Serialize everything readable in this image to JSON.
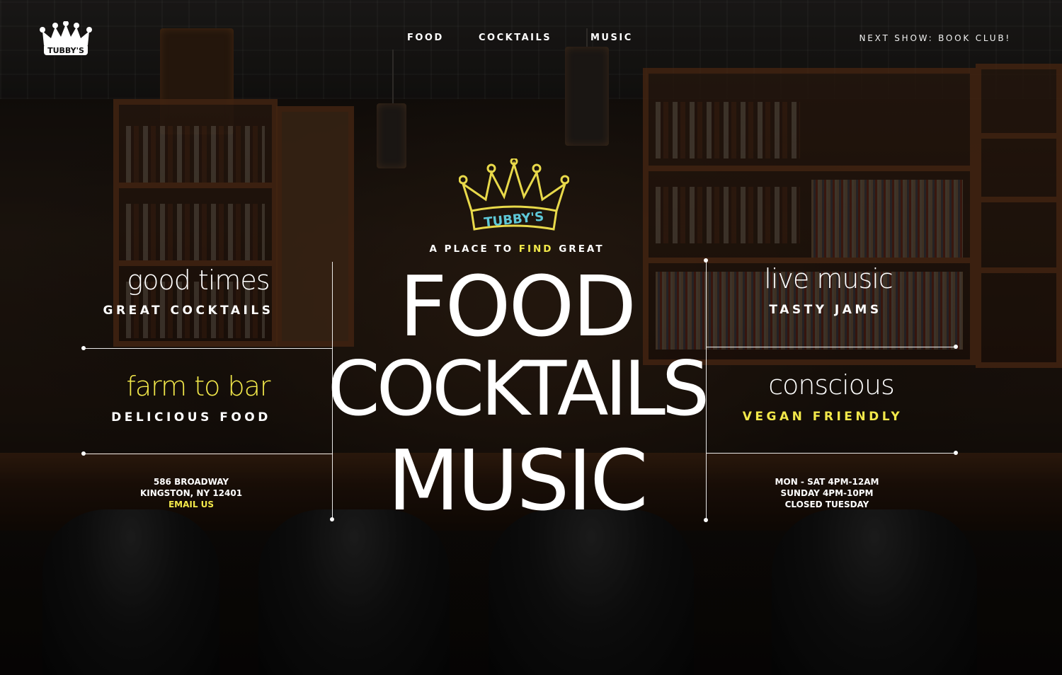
{
  "nav": {
    "logo_text": "TUBBY'S",
    "links": [
      {
        "label": "FOOD"
      },
      {
        "label": "COCKTAILS"
      },
      {
        "label": "MUSIC"
      }
    ],
    "next_show": "NEXT SHOW: BOOK CLUB!"
  },
  "hero": {
    "neon_sign_text": "TUBBY'S",
    "kicker": {
      "before": "A PLACE TO ",
      "highlight": "FIND",
      "after": " GREAT"
    },
    "words": [
      "FOOD",
      "COCKTAILS",
      "MUSIC"
    ]
  },
  "left": {
    "top": {
      "title": "good times",
      "subtitle": "GREAT COCKTAILS"
    },
    "bottom": {
      "title": "farm to bar",
      "subtitle": "DELICIOUS FOOD"
    },
    "address": {
      "line1": "586 BROADWAY",
      "line2": "KINGSTON, NY 12401",
      "email": "EMAIL US"
    }
  },
  "right": {
    "top": {
      "title": "live music",
      "subtitle": "TASTY JAMS"
    },
    "bottom": {
      "title": "conscious",
      "subtitle": "VEGAN FRIENDLY"
    },
    "hours": {
      "line1": "MON - SAT 4PM-12AM",
      "line2": "SUNDAY 4PM-10PM",
      "line3": "CLOSED TUESDAY"
    }
  },
  "colors": {
    "accent": "#f2e84a",
    "text": "#ffffff"
  }
}
